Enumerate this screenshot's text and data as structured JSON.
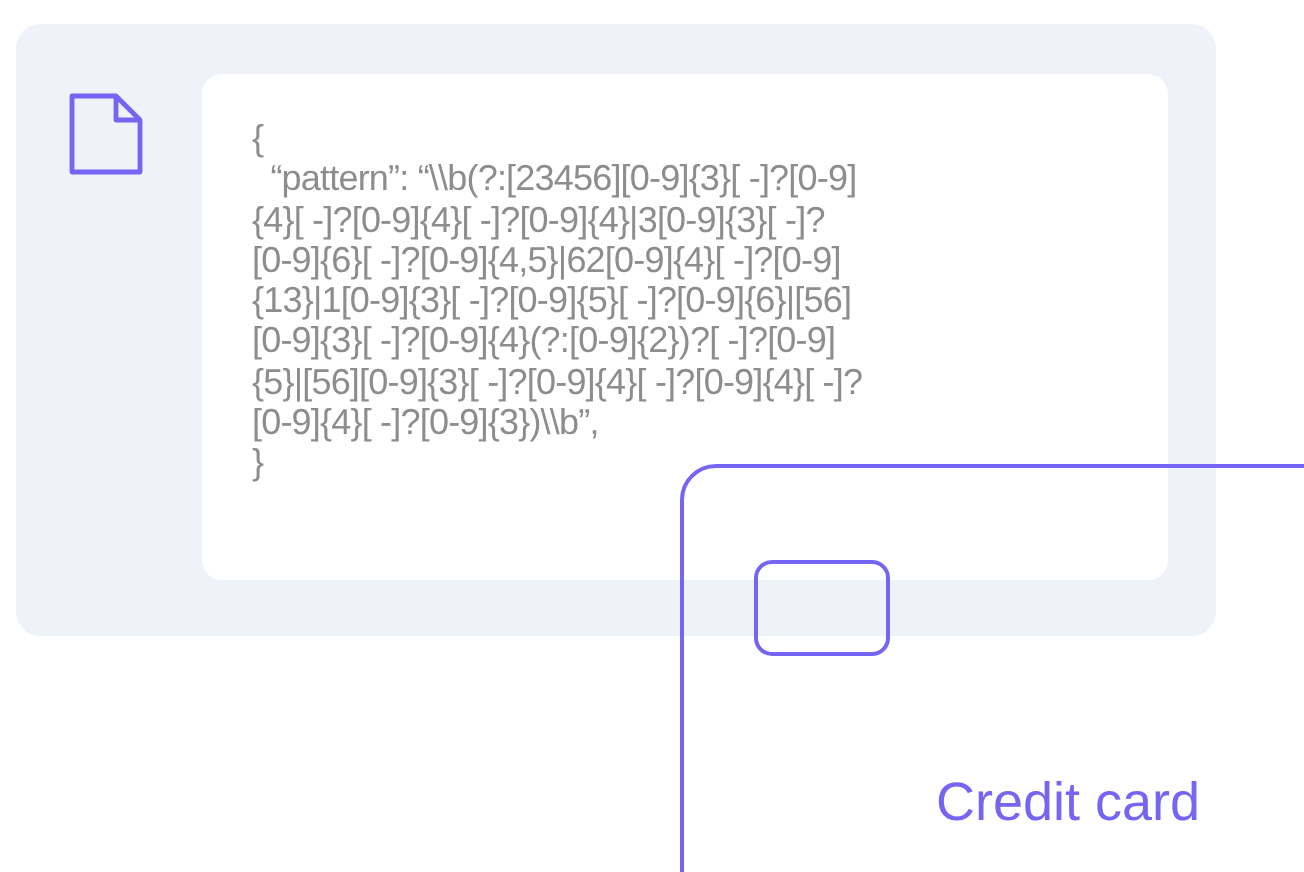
{
  "code_lines": [
    "{",
    "  “pattern”: “\\\\b(?:[23456][0-9]{3}[ -]?[0-9]",
    "{4}[ -]?[0-9]{4}[ -]?[0-9]{4}|3[0-9]{3}[ -]?",
    "[0-9]{6}[ -]?[0-9]{4,5}|62[0-9]{4}[ -]?[0-9]",
    "{13}|1[0-9]{3}[ -]?[0-9]{5}[ -]?[0-9]{6}|[56]",
    "[0-9]{3}[ -]?[0-9]{4}(?:[0-9]{2})?[ -]?[0-9]",
    "{5}|[56][0-9]{3}[ -]?[0-9]{4}[ -]?[0-9]{4}[ -]?",
    "[0-9]{4}[ -]?[0-9]{3})\\\\b”,",
    "}"
  ],
  "card": {
    "label": "Credit card"
  }
}
